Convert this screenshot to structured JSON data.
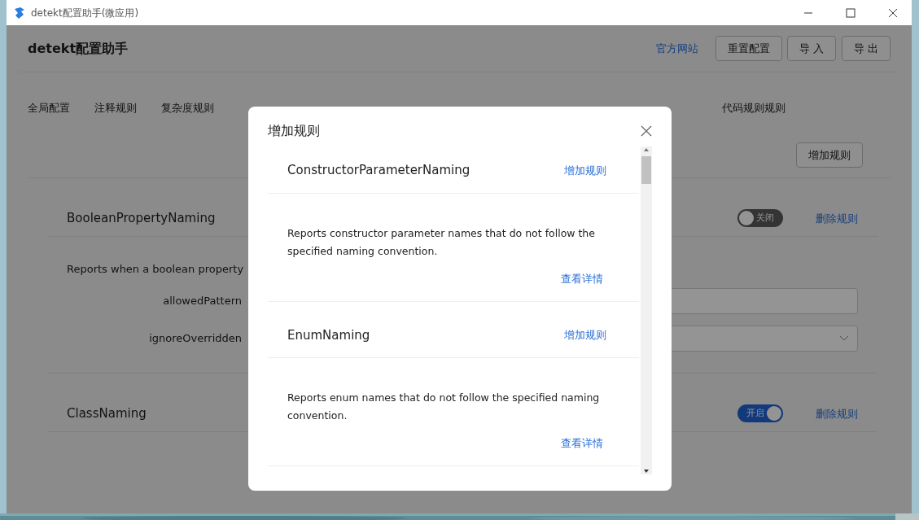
{
  "window": {
    "title": "detekt配置助手(微应用)"
  },
  "header": {
    "title": "detekt配置助手",
    "link": "官方网站",
    "buttons": [
      "重置配置",
      "导 入",
      "导 出"
    ]
  },
  "tabs": [
    {
      "label": "全局配置",
      "selected": false
    },
    {
      "label": "注释规则",
      "selected": false
    },
    {
      "label": "复杂度规则",
      "selected": false
    },
    {
      "label": "代码规则规则",
      "selected": false
    }
  ],
  "add_rule_button": "增加规则",
  "rules": [
    {
      "name": "BooleanPropertyNaming",
      "enabled": false,
      "switch_label": "关闭",
      "delete_link": "删除规则",
      "description": "Reports when a boolean property",
      "fields": [
        {
          "label": "allowedPattern",
          "kind": "text"
        },
        {
          "label": "ignoreOverridden",
          "kind": "select"
        }
      ]
    },
    {
      "name": "ClassNaming",
      "enabled": true,
      "switch_label": "开启",
      "delete_link": "删除规则"
    }
  ],
  "dialog": {
    "title": "增加规则",
    "items": [
      {
        "name": "ConstructorParameterNaming",
        "add_link": "增加规则",
        "description": "Reports constructor parameter names that do not follow the specified naming convention.",
        "details_link": "查看详情"
      },
      {
        "name": "EnumNaming",
        "add_link": "增加规则",
        "description": "Reports enum names that do not follow the specified naming convention.",
        "details_link": "查看详情"
      }
    ]
  }
}
